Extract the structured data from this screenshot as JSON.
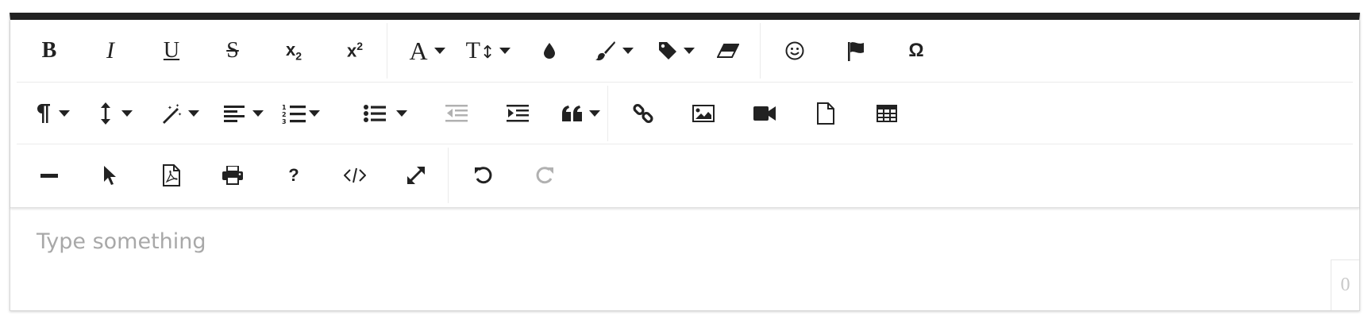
{
  "editor": {
    "placeholder": "Type something",
    "char_count": "0"
  },
  "toolbar": {
    "row1": {
      "bold": "B",
      "italic": "I",
      "underline": "U",
      "strikethrough": "S",
      "subscript": "x",
      "subscript_digit": "2",
      "superscript": "x",
      "superscript_digit": "2",
      "font_family": "A",
      "font_size": "T",
      "special_character": "Ω"
    },
    "disabled_buttons": [
      "outdent",
      "redo"
    ],
    "colors": {
      "icon": "#222222",
      "disabled_icon": "#bdbdbd",
      "top_bar": "#222222",
      "placeholder": "#a8a8a8"
    }
  }
}
